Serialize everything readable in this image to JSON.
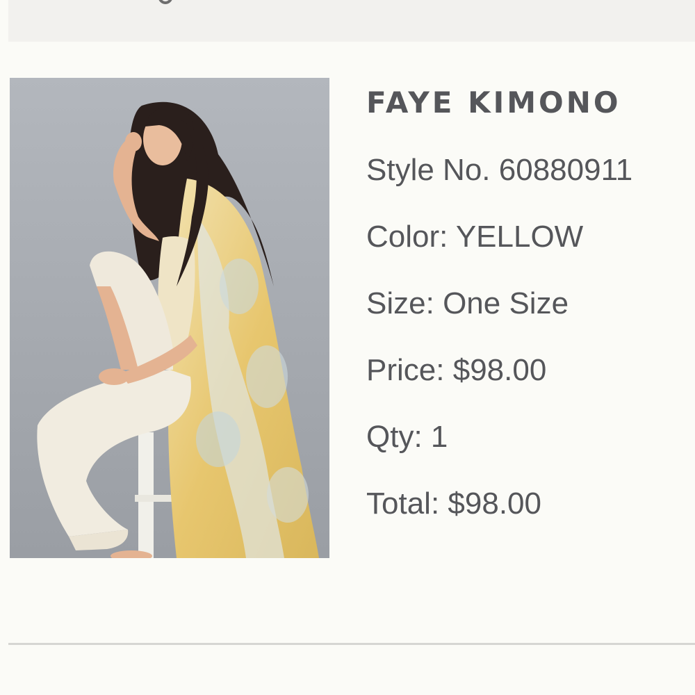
{
  "product": {
    "name": "FAYE KIMONO",
    "image_alt": "Model wearing a yellow floral kimono seated on a stool",
    "style_label": "Style No.",
    "style_number": "60880911",
    "color_label": "Color:",
    "color_value": "YELLOW",
    "size_label": "Size:",
    "size_value": "One Size",
    "price_label": "Price:",
    "price_value": "$98.00",
    "qty_label": "Qty:",
    "qty_value": "1",
    "total_label": "Total:",
    "total_value": "$98.00"
  },
  "colors": {
    "background": "#fbfbf7",
    "banner": "#f2f1ee",
    "text": "#55565a",
    "divider": "#d6d6d3",
    "photo_backdrop": "#a9adb3"
  }
}
